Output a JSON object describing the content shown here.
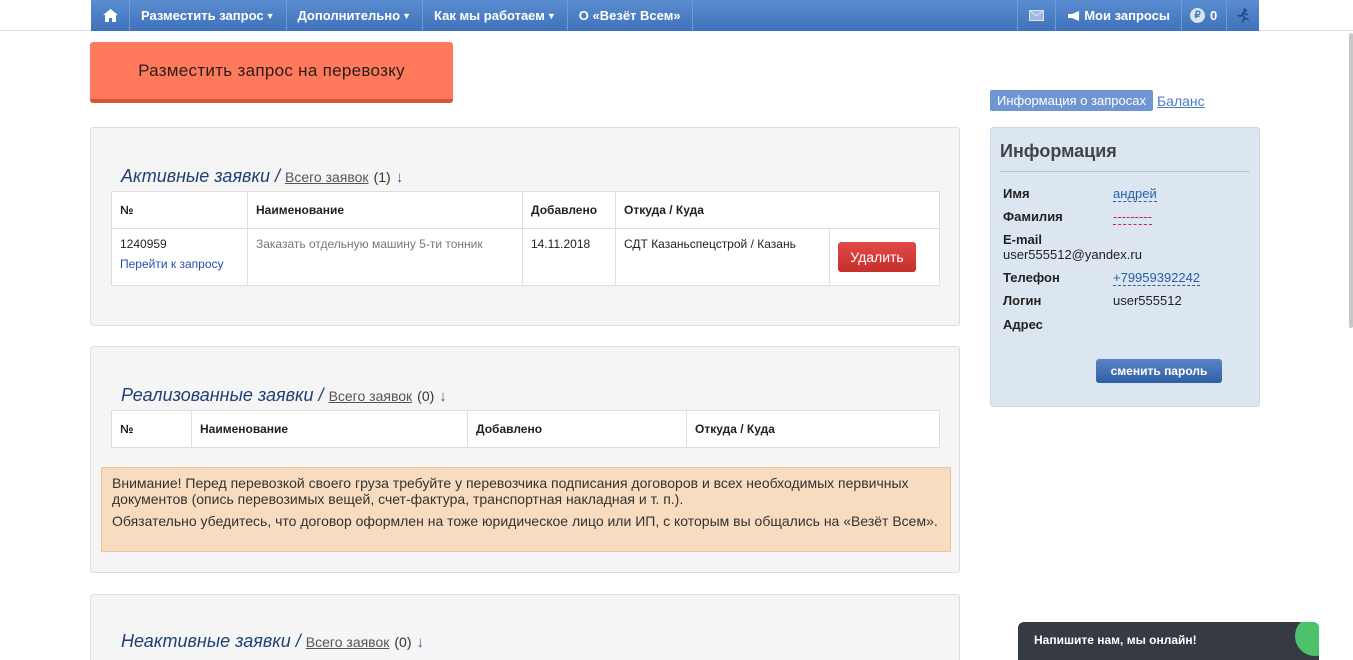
{
  "nav": {
    "items": [
      {
        "label": "Разместить запрос",
        "dropdown": true
      },
      {
        "label": "Дополнительно",
        "dropdown": true
      },
      {
        "label": "Как мы работаем",
        "dropdown": true
      },
      {
        "label": "О «Везёт Всем»",
        "dropdown": false
      }
    ],
    "my_requests": "Мои запросы",
    "coin_symbol": "₽",
    "balance_count": "0"
  },
  "main_button": "Разместить запрос на перевозку",
  "active": {
    "title": "Активные заявки /",
    "all_link": "Всего заявок",
    "count": "(1)",
    "arrow": "↓",
    "headers": [
      "№",
      "Наименование",
      "Добавлено",
      "Откуда / Куда"
    ],
    "rows": [
      {
        "id": "1240959",
        "link": "Перейти к запросу",
        "name": "Заказать отдельную машину 5-ти тонник",
        "added": "14.11.2018",
        "route": "СДТ Казаньспецстрой / Казань",
        "delete": "Удалить"
      }
    ]
  },
  "done": {
    "title": "Реализованные заявки /",
    "all_link": "Всего заявок",
    "count": "(0)",
    "arrow": "↓",
    "headers": [
      "№",
      "Наименование",
      "Добавлено",
      "Откуда / Куда"
    ]
  },
  "warning": {
    "p1": "Внимание! Перед перевозкой своего груза требуйте у перевозчика подписания договоров и всех необходимых первичных документов (опись перевозимых вещей, счет-фактура, транспортная накладная и т. п.).",
    "p2": "Обязательно убедитесь, что договор оформлен на тоже юридическое лицо или ИП, с которым вы общались на «Везёт Всем»."
  },
  "inactive": {
    "title": "Неактивные заявки /",
    "all_link": "Всего заявок",
    "count": "(0)",
    "arrow": "↓"
  },
  "tabs": {
    "active": "Информация о запросах",
    "other": "Баланс"
  },
  "info": {
    "title": "Информация",
    "name_label": "Имя",
    "name": "андрей",
    "surname_label": "Фамилия",
    "surname": "---------",
    "email_label": "E-mail",
    "email": "user555512@yandex.ru",
    "phone_label": "Телефон",
    "phone": "+79959392242",
    "login_label": "Логин",
    "login": "user555512",
    "address_label": "Адрес",
    "change_password": "сменить пароль"
  },
  "chat": "Напишите нам, мы онлайн!"
}
